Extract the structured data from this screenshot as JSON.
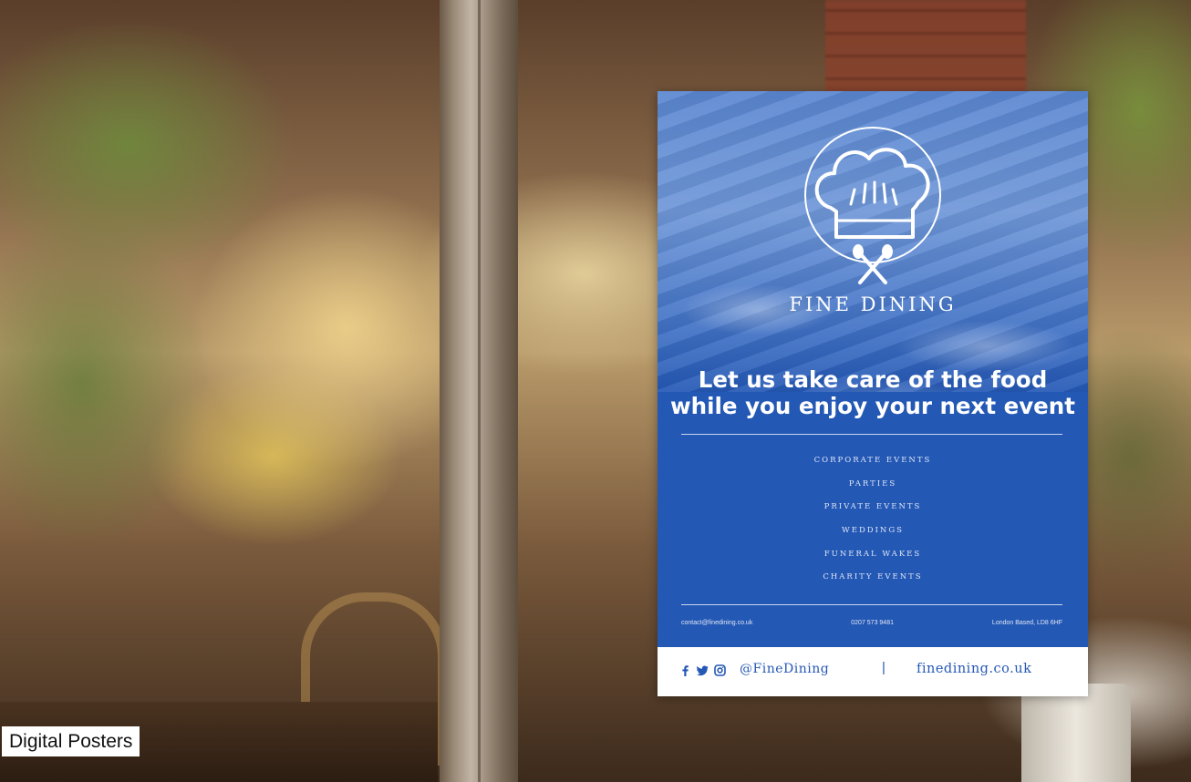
{
  "caption": "Digital Posters",
  "poster": {
    "brand": "FINE DINING",
    "headline_line1": "Let us take care of the food",
    "headline_line2": "while you enjoy your next event",
    "services": [
      "CORPORATE EVENTS",
      "PARTIES",
      "PRIVATE EVENTS",
      "WEDDINGS",
      "FUNERAL WAKES",
      "CHARITY EVENTS"
    ],
    "contacts": {
      "email": "contact@finedining.co.uk",
      "phone": "0207 573 9481",
      "location": "London Based, LD8 6HF"
    },
    "footer": {
      "social_icons": [
        "facebook-icon",
        "twitter-icon",
        "instagram-icon"
      ],
      "handle": "@FineDining",
      "divider": "|",
      "website": "finedining.co.uk"
    },
    "colors": {
      "poster_blue": "#2458b5",
      "footer_bg": "#ffffff",
      "text_light": "#ffffff"
    }
  }
}
